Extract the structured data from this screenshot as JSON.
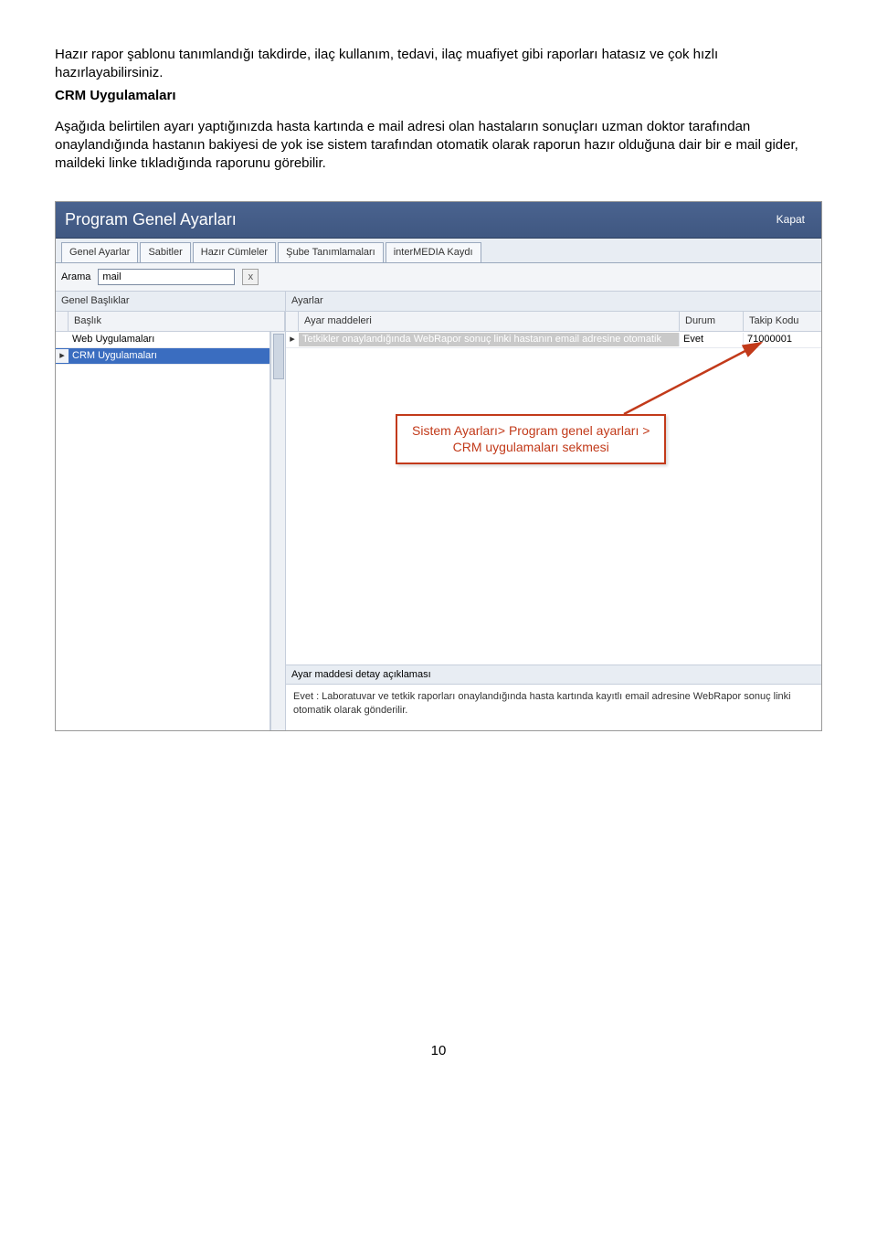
{
  "doc": {
    "para1": "Hazır rapor şablonu tanımlandığı takdirde, ilaç kullanım, tedavi, ilaç muafiyet gibi raporları hatasız ve çok hızlı hazırlayabilirsiniz.",
    "crm_title": "CRM Uygulamaları",
    "para2": "Aşağıda belirtilen ayarı yaptığınızda hasta kartında e mail adresi olan hastaların sonuçları uzman doktor tarafından onaylandığında hastanın bakiyesi de yok ise sistem tarafından otomatik olarak raporun hazır olduğuna dair bir e mail gider, maildeki linke tıkladığında raporunu görebilir."
  },
  "window": {
    "title": "Program Genel Ayarları",
    "close": "Kapat"
  },
  "tabs": [
    "Genel Ayarlar",
    "Sabitler",
    "Hazır Cümleler",
    "Şube Tanımlamaları",
    "interMEDIA Kaydı"
  ],
  "search": {
    "label": "Arama",
    "value": "mail",
    "clear": "x"
  },
  "left": {
    "group_title": "Genel Başlıklar",
    "header": "Başlık",
    "rows": [
      {
        "text": "Web Uygulamaları",
        "selected": false,
        "indicator": ""
      },
      {
        "text": "CRM Uygulamaları",
        "selected": true,
        "indicator": "▸"
      }
    ]
  },
  "right": {
    "group_title": "Ayarlar",
    "headers": {
      "madd": "Ayar maddeleri",
      "durum": "Durum",
      "takip": "Takip Kodu"
    },
    "rows": [
      {
        "indicator": "▸",
        "madd": "Tetkikler onaylandığında WebRapor sonuç linki hastanın email adresine otomatik",
        "durum": "Evet",
        "takip": "71000001",
        "selected": true
      }
    ]
  },
  "callout": {
    "line1": "Sistem Ayarları>  Program genel ayarları >",
    "line2": "CRM uygulamaları sekmesi"
  },
  "detail": {
    "title": "Ayar maddesi detay açıklaması",
    "text": "Evet : Laboratuvar ve tetkik raporları onaylandığında hasta kartında kayıtlı email adresine WebRapor sonuç linki otomatik olarak gönderilir."
  },
  "page_number": "10"
}
